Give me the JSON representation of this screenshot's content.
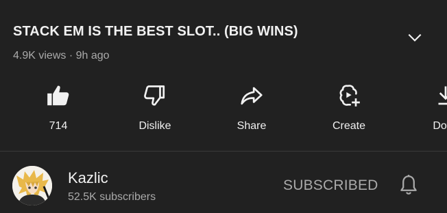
{
  "video": {
    "title": "STACK EM IS THE BEST SLOT.. (BIG WINS)",
    "meta": "4.9K views · 9h ago"
  },
  "actions": {
    "like": {
      "label": "714",
      "icon": "thumbs-up-icon"
    },
    "dislike": {
      "label": "Dislike",
      "icon": "thumbs-down-icon"
    },
    "share": {
      "label": "Share",
      "icon": "share-arrow-icon"
    },
    "create": {
      "label": "Create",
      "icon": "create-clip-icon"
    },
    "download": {
      "label": "Dowr",
      "icon": "download-icon"
    }
  },
  "channel": {
    "name": "Kazlic",
    "subscribers": "52.5K subscribers",
    "subscribe_label": "SUBSCRIBED"
  },
  "colors": {
    "background": "#212121",
    "primary_text": "#f1f1f1",
    "secondary_text": "#aaaaaa"
  }
}
